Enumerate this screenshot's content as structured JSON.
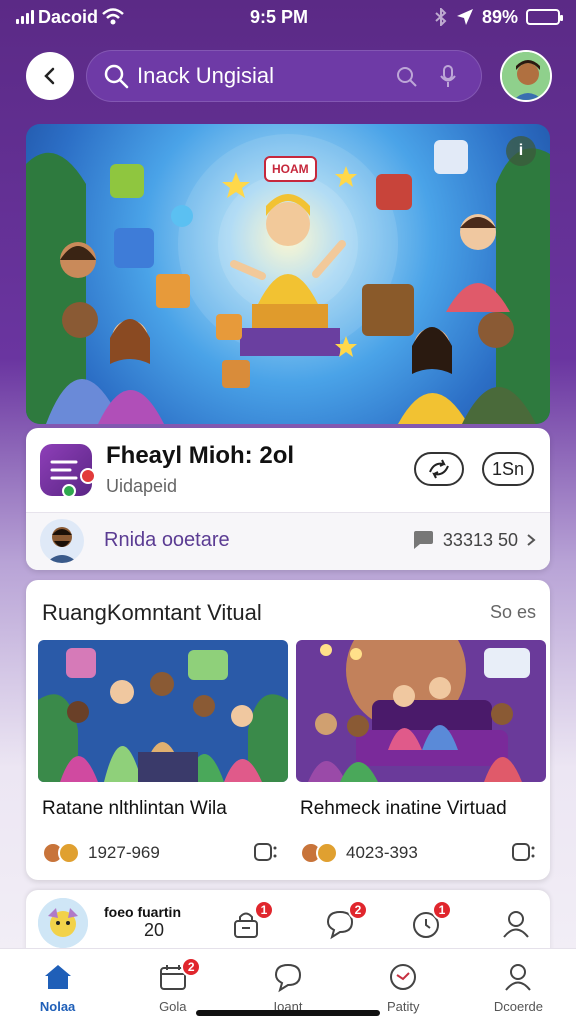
{
  "status_bar": {
    "carrier": "Dacoid",
    "time": "9:5 PM",
    "battery": "89%"
  },
  "header": {
    "search_placeholder": "Inack Ungisial"
  },
  "hero": {
    "banner_text": "HOAM"
  },
  "featured_app": {
    "title": "Fheayl Mioh: 2ol",
    "subtitle": "Uidapeid",
    "count": "1Sn",
    "footer_text": "Rnida ooetare",
    "footer_stat": "33313 50"
  },
  "rooms_section": {
    "title": "RuangKomntant Vitual",
    "see_all": "So es",
    "items": [
      {
        "caption": "Ratane nlthlintan Wila",
        "count": "1927-969"
      },
      {
        "caption": "Rehmeck inatine Virtuad",
        "count": "4023-393"
      }
    ]
  },
  "bottom_strip": {
    "title": "foeo fuartin",
    "number": "20",
    "badges": [
      "1",
      "2",
      "1"
    ]
  },
  "tab_bar": {
    "items": [
      {
        "label": "Nolaa",
        "icon": "home-icon",
        "active": true
      },
      {
        "label": "Gola",
        "icon": "calendar-icon",
        "badge": "2"
      },
      {
        "label": "Ioant",
        "icon": "chat-icon"
      },
      {
        "label": "Patity",
        "icon": "activity-icon"
      },
      {
        "label": "Dcoerde",
        "icon": "profile-icon"
      }
    ]
  },
  "colors": {
    "header_purple": "#5b2a86",
    "accent_blue": "#1f5fb8",
    "badge_red": "#e0262d",
    "battery_green": "#3ccf4e"
  }
}
